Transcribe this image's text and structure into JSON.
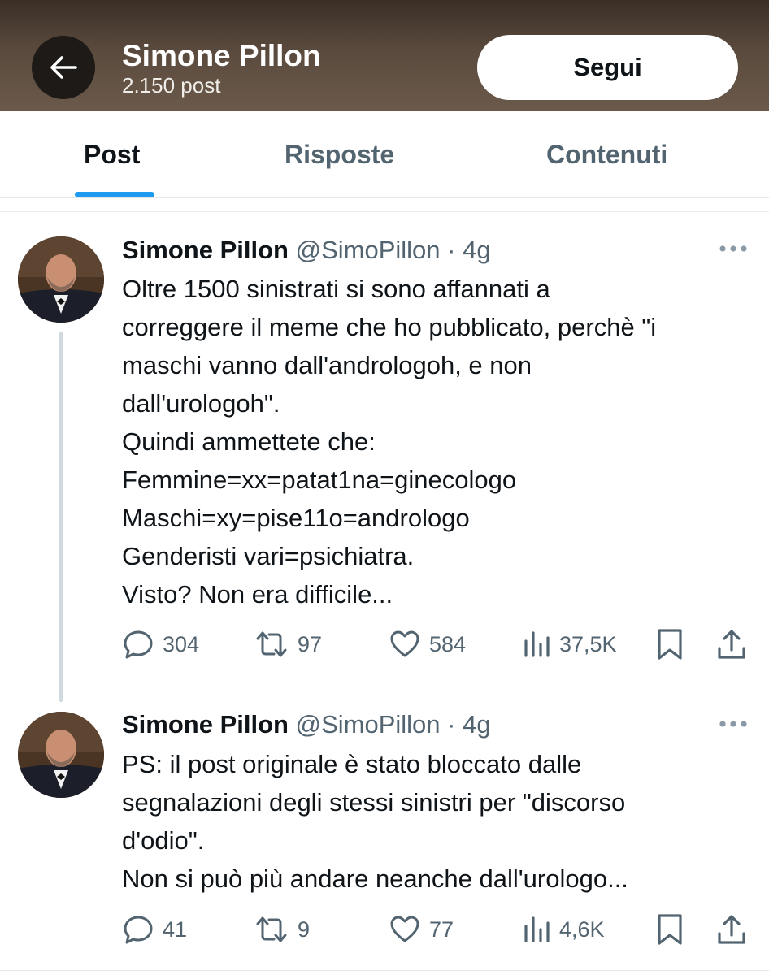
{
  "header": {
    "title": "Simone Pillon",
    "subtitle": "2.150 post",
    "follow_label": "Segui"
  },
  "tabs": [
    {
      "label": "Post",
      "active": true
    },
    {
      "label": "Risposte",
      "active": false
    },
    {
      "label": "Contenuti",
      "active": false
    }
  ],
  "tweets": [
    {
      "name": "Simone Pillon",
      "handle": "@SimoPillon",
      "time": "· 4g",
      "text": "Oltre 1500 sinistrati si sono affannati a\ncorreggere il meme che ho pubblicato, perchè \"i\nmaschi vanno dall'andrologoh, e non\ndall'urologoh\".\nQuindi ammettete che:\nFemmine=xx=patat1na=ginecologo\nMaschi=xy=pise11o=andrologo\nGenderisti vari=psichiatra.\nVisto? Non era difficile...",
      "replies": "304",
      "reposts": "97",
      "likes": "584",
      "views": "37,5K"
    },
    {
      "name": "Simone Pillon",
      "handle": "@SimoPillon",
      "time": "· 4g",
      "text": "PS: il post originale è stato bloccato dalle\nsegnalazioni degli stessi sinistri per \"discorso\nd'odio\".\nNon si può più andare neanche dall'urologo...",
      "replies": "41",
      "reposts": "9",
      "likes": "77",
      "views": "4,6K"
    }
  ],
  "icons": {
    "back": "arrow-left-icon",
    "more": "more-icon",
    "reply": "reply-icon",
    "repost": "repost-icon",
    "like": "heart-icon",
    "views": "views-icon",
    "bookmark": "bookmark-icon",
    "share": "share-icon"
  },
  "colors": {
    "accent": "#1d9bf0",
    "text": "#0f1419",
    "secondary": "#536471"
  }
}
